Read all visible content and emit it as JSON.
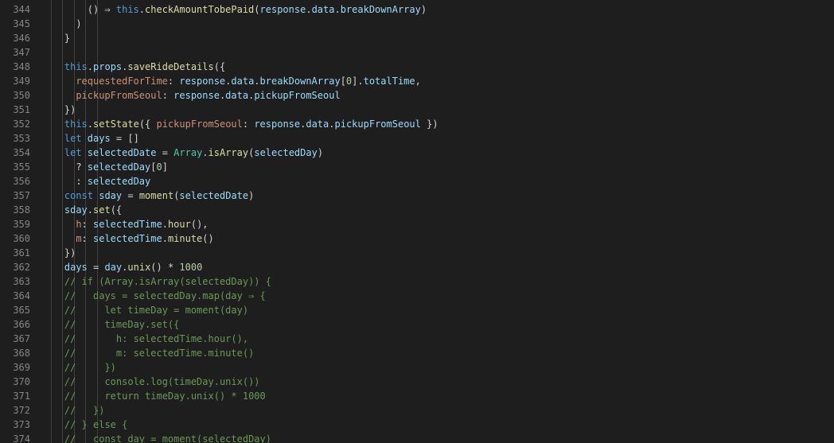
{
  "editor": {
    "lines": [
      {
        "n": "344",
        "indent": 8,
        "tokens": [
          [
            "op",
            "() ⇒ "
          ],
          [
            "kw",
            "this"
          ],
          [
            "op",
            "."
          ],
          [
            "fn",
            "checkAmountTobePaid"
          ],
          [
            "op",
            "("
          ],
          [
            "var",
            "response"
          ],
          [
            "op",
            "."
          ],
          [
            "var",
            "data"
          ],
          [
            "op",
            "."
          ],
          [
            "var",
            "breakDownArray"
          ],
          [
            "op",
            ")"
          ]
        ]
      },
      {
        "n": "345",
        "indent": 6,
        "tokens": [
          [
            "op",
            ")"
          ]
        ]
      },
      {
        "n": "346",
        "indent": 4,
        "tokens": [
          [
            "op",
            "}"
          ]
        ]
      },
      {
        "n": "347",
        "indent": 0,
        "tokens": []
      },
      {
        "n": "348",
        "indent": 4,
        "tokens": [
          [
            "kw",
            "this"
          ],
          [
            "op",
            "."
          ],
          [
            "var",
            "props"
          ],
          [
            "op",
            "."
          ],
          [
            "fn",
            "saveRideDetails"
          ],
          [
            "op",
            "({"
          ]
        ]
      },
      {
        "n": "349",
        "indent": 6,
        "tokens": [
          [
            "key",
            "requestedForTime"
          ],
          [
            "op",
            ": "
          ],
          [
            "var",
            "response"
          ],
          [
            "op",
            "."
          ],
          [
            "var",
            "data"
          ],
          [
            "op",
            "."
          ],
          [
            "var",
            "breakDownArray"
          ],
          [
            "op",
            "["
          ],
          [
            "num",
            "0"
          ],
          [
            "op",
            "]."
          ],
          [
            "var",
            "totalTime"
          ],
          [
            "op",
            ","
          ]
        ]
      },
      {
        "n": "350",
        "indent": 6,
        "tokens": [
          [
            "key",
            "pickupFromSeoul"
          ],
          [
            "op",
            ": "
          ],
          [
            "var",
            "response"
          ],
          [
            "op",
            "."
          ],
          [
            "var",
            "data"
          ],
          [
            "op",
            "."
          ],
          [
            "var",
            "pickupFromSeoul"
          ]
        ]
      },
      {
        "n": "351",
        "indent": 4,
        "tokens": [
          [
            "op",
            "})"
          ]
        ]
      },
      {
        "n": "352",
        "indent": 4,
        "tokens": [
          [
            "kw",
            "this"
          ],
          [
            "op",
            "."
          ],
          [
            "fn",
            "setState"
          ],
          [
            "op",
            "({ "
          ],
          [
            "key",
            "pickupFromSeoul"
          ],
          [
            "op",
            ": "
          ],
          [
            "var",
            "response"
          ],
          [
            "op",
            "."
          ],
          [
            "var",
            "data"
          ],
          [
            "op",
            "."
          ],
          [
            "var",
            "pickupFromSeoul"
          ],
          [
            "op",
            " })"
          ]
        ]
      },
      {
        "n": "353",
        "indent": 4,
        "tokens": [
          [
            "kw",
            "let "
          ],
          [
            "var",
            "days"
          ],
          [
            "op",
            " = []"
          ]
        ]
      },
      {
        "n": "354",
        "indent": 4,
        "tokens": [
          [
            "kw",
            "let "
          ],
          [
            "var",
            "selectedDate"
          ],
          [
            "op",
            " = "
          ],
          [
            "cls",
            "Array"
          ],
          [
            "op",
            "."
          ],
          [
            "fn",
            "isArray"
          ],
          [
            "op",
            "("
          ],
          [
            "var",
            "selectedDay"
          ],
          [
            "op",
            ")"
          ]
        ]
      },
      {
        "n": "355",
        "indent": 6,
        "tokens": [
          [
            "op",
            "? "
          ],
          [
            "var",
            "selectedDay"
          ],
          [
            "op",
            "["
          ],
          [
            "num",
            "0"
          ],
          [
            "op",
            "]"
          ]
        ]
      },
      {
        "n": "356",
        "indent": 6,
        "tokens": [
          [
            "op",
            ": "
          ],
          [
            "var",
            "selectedDay"
          ]
        ]
      },
      {
        "n": "357",
        "indent": 4,
        "tokens": [
          [
            "kw",
            "const "
          ],
          [
            "var",
            "sday"
          ],
          [
            "op",
            " = "
          ],
          [
            "fn",
            "moment"
          ],
          [
            "op",
            "("
          ],
          [
            "var",
            "selectedDate"
          ],
          [
            "op",
            ")"
          ]
        ]
      },
      {
        "n": "358",
        "indent": 4,
        "tokens": [
          [
            "var",
            "sday"
          ],
          [
            "op",
            "."
          ],
          [
            "fn",
            "set"
          ],
          [
            "op",
            "({"
          ]
        ]
      },
      {
        "n": "359",
        "indent": 6,
        "tokens": [
          [
            "key",
            "h"
          ],
          [
            "op",
            ": "
          ],
          [
            "var",
            "selectedTime"
          ],
          [
            "op",
            "."
          ],
          [
            "fn",
            "hour"
          ],
          [
            "op",
            "(),"
          ]
        ]
      },
      {
        "n": "360",
        "indent": 6,
        "tokens": [
          [
            "key",
            "m"
          ],
          [
            "op",
            ": "
          ],
          [
            "var",
            "selectedTime"
          ],
          [
            "op",
            "."
          ],
          [
            "fn",
            "minute"
          ],
          [
            "op",
            "()"
          ]
        ]
      },
      {
        "n": "361",
        "indent": 4,
        "tokens": [
          [
            "op",
            "})"
          ]
        ]
      },
      {
        "n": "362",
        "indent": 4,
        "tokens": [
          [
            "var",
            "days"
          ],
          [
            "op",
            " = "
          ],
          [
            "var",
            "day"
          ],
          [
            "op",
            "."
          ],
          [
            "fn",
            "unix"
          ],
          [
            "op",
            "() * "
          ],
          [
            "num",
            "1000"
          ]
        ]
      },
      {
        "n": "363",
        "indent": 4,
        "tokens": [
          [
            "cm",
            "// if (Array.isArray(selectedDay)) {"
          ]
        ]
      },
      {
        "n": "364",
        "indent": 4,
        "tokens": [
          [
            "cm",
            "//   days = selectedDay.map(day ⇒ {"
          ]
        ]
      },
      {
        "n": "365",
        "indent": 4,
        "tokens": [
          [
            "cm",
            "//     let timeDay = moment(day)"
          ]
        ]
      },
      {
        "n": "366",
        "indent": 4,
        "tokens": [
          [
            "cm",
            "//     timeDay.set({"
          ]
        ]
      },
      {
        "n": "367",
        "indent": 4,
        "tokens": [
          [
            "cm",
            "//       h: selectedTime.hour(),"
          ]
        ]
      },
      {
        "n": "368",
        "indent": 4,
        "tokens": [
          [
            "cm",
            "//       m: selectedTime.minute()"
          ]
        ]
      },
      {
        "n": "369",
        "indent": 4,
        "tokens": [
          [
            "cm",
            "//     })"
          ]
        ]
      },
      {
        "n": "370",
        "indent": 4,
        "tokens": [
          [
            "cm",
            "//     console.log(timeDay.unix())"
          ]
        ]
      },
      {
        "n": "371",
        "indent": 4,
        "tokens": [
          [
            "cm",
            "//     return timeDay.unix() * 1000"
          ]
        ]
      },
      {
        "n": "372",
        "indent": 4,
        "tokens": [
          [
            "cm",
            "//   })"
          ]
        ]
      },
      {
        "n": "373",
        "indent": 4,
        "tokens": [
          [
            "cm",
            "// } else {"
          ]
        ]
      },
      {
        "n": "374",
        "indent": 4,
        "tokens": [
          [
            "cm",
            "//   const day = moment(selectedDay)"
          ]
        ]
      }
    ]
  }
}
